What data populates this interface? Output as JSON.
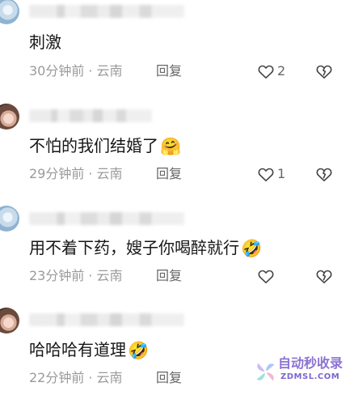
{
  "comments": [
    {
      "text": "刺激",
      "emoji": "",
      "time": "30分钟前",
      "location": "云南",
      "reply_label": "回复",
      "like_count": "2"
    },
    {
      "text": "不怕的我们结婚了",
      "emoji": "🤗",
      "time": "29分钟前",
      "location": "云南",
      "reply_label": "回复",
      "like_count": "1"
    },
    {
      "text": "用不着下药，嫂子你喝醉就行",
      "emoji": "🤣",
      "time": "23分钟前",
      "location": "云南",
      "reply_label": "回复",
      "like_count": ""
    },
    {
      "text": "哈哈哈有道理",
      "emoji": "🤣",
      "time": "22分钟前",
      "location": "云南",
      "reply_label": "回复",
      "like_count": ""
    }
  ],
  "meta_separator": "·",
  "watermark": {
    "title": "自动秒收录",
    "subtitle": "ZDMSL.COM"
  },
  "colors": {
    "text": "#161616",
    "meta_text": "#9a9a9a",
    "action_text": "#666666",
    "watermark": "#8b74d1"
  },
  "icons": {
    "like": "heart-outline-icon",
    "dislike": "broken-heart-outline-icon",
    "watermark_logo": "pinwheel-logo-icon"
  }
}
